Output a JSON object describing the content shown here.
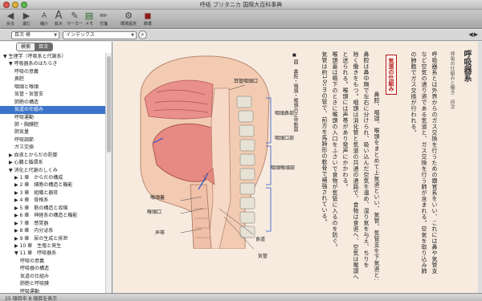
{
  "window": {
    "title": "呼吸 ブリタニカ 国際大百科事典"
  },
  "toolbar": {
    "buttons": [
      {
        "name": "back-button",
        "icon": "◀",
        "label": "戻る"
      },
      {
        "name": "forward-button",
        "icon": "▶",
        "label": "進む"
      },
      {
        "name": "font-smaller-button",
        "icon": "A",
        "label": "縮小"
      },
      {
        "name": "font-larger-button",
        "icon": "A",
        "label": "拡大"
      },
      {
        "name": "marker-button",
        "icon": "✎",
        "label": "マーカー"
      },
      {
        "name": "memo-button",
        "icon": "▤",
        "label": "メモ"
      },
      {
        "name": "note-button",
        "icon": "✏",
        "label": "付箋"
      },
      {
        "name": "settings-button",
        "icon": "⚙",
        "label": "環境設定"
      },
      {
        "name": "dictionary-button",
        "icon": "◼",
        "label": "辞書"
      }
    ]
  },
  "search": {
    "scope": "目次 検",
    "field": "インデックス"
  },
  "sidebar": {
    "tabs": [
      "検索",
      "目次"
    ],
    "tree": [
      {
        "label": "▼ 生理学（呼吸系と代謝系）",
        "indent": 0,
        "expanded": true,
        "selected": false
      },
      {
        "label": "▼ 呼吸器系のはたらき",
        "indent": 1,
        "expanded": true,
        "selected": false
      },
      {
        "label": "呼吸の意義",
        "indent": 2,
        "selected": false
      },
      {
        "label": "鼻腔",
        "indent": 2,
        "selected": false
      },
      {
        "label": "咽頭と喉頭",
        "indent": 2,
        "selected": false
      },
      {
        "label": "気管・気管支",
        "indent": 2,
        "selected": false
      },
      {
        "label": "肺胞の構造",
        "indent": 2,
        "selected": false
      },
      {
        "label": "気道の仕組み",
        "indent": 2,
        "selected": true
      },
      {
        "label": "呼吸運動",
        "indent": 2,
        "selected": false
      },
      {
        "label": "肺・胸膜腔",
        "indent": 2,
        "selected": false
      },
      {
        "label": "肺気量",
        "indent": 2,
        "selected": false
      },
      {
        "label": "呼吸調節",
        "indent": 2,
        "selected": false
      },
      {
        "label": "ガス交換",
        "indent": 2,
        "selected": false
      },
      {
        "label": "▶ 血液とからだの防御",
        "indent": 1,
        "selected": false
      },
      {
        "label": "▶ 心臓と循環系",
        "indent": 1,
        "selected": false
      },
      {
        "label": "▼ 消化と代謝のしくみ",
        "indent": 1,
        "expanded": true,
        "selected": false
      },
      {
        "label": "▶ 1 章　からだの構成",
        "indent": 2,
        "selected": false
      },
      {
        "label": "▶ 2 章　細胞の構造と機能",
        "indent": 2,
        "selected": false
      },
      {
        "label": "▶ 3 章　組織と器官",
        "indent": 2,
        "selected": false
      },
      {
        "label": "▶ 4 章　骨格系",
        "indent": 2,
        "selected": false
      },
      {
        "label": "▶ 5 章　筋の構造と収縮",
        "indent": 2,
        "selected": false
      },
      {
        "label": "▶ 6 章　神経系の構造と機能",
        "indent": 2,
        "selected": false
      },
      {
        "label": "▶ 7 章　感覚器",
        "indent": 2,
        "selected": false
      },
      {
        "label": "▶ 8 章　内分泌系",
        "indent": 2,
        "selected": false
      },
      {
        "label": "▶ 9 章　尿の生成と排泄",
        "indent": 2,
        "selected": false
      },
      {
        "label": "▶ 10 章　生殖と発生",
        "indent": 2,
        "selected": false
      },
      {
        "label": "▼ 11 章　呼吸器系",
        "indent": 2,
        "expanded": true,
        "selected": false
      },
      {
        "label": "呼吸の意義",
        "indent": 3,
        "selected": false
      },
      {
        "label": "呼吸器の構造",
        "indent": 3,
        "selected": false
      },
      {
        "label": "気道の仕組み",
        "indent": 3,
        "selected": false
      },
      {
        "label": "肺胞と呼吸膜",
        "indent": 3,
        "selected": false
      },
      {
        "label": "呼吸運動",
        "indent": 3,
        "selected": false
      }
    ]
  },
  "article": {
    "heading": "呼吸器系",
    "subheading": "呼吸の仕組みと働き　目次",
    "boxed_term": "気道の仕組み",
    "columns": [
      "呼吸器系とは外界からのガス交換を行うための器官系をいい、これには鼻や気管支",
      "など空気の通り道である気道と、ガス交換を行う肺が含まれる。空気を取り込み肺",
      "の肺胞でガス交換が行われる。",
      "鼻腔、咽頭、喉頭をまとめて上気道といい、気管、気管支を下気道という。",
      "鼻腔は鼻中隔で左右に分けられ、吸い込んだ空気を温め、湿り気を与え、ちりを",
      "除く働きをもつ。咽頭は消化管と気道の共通の通路で、食物は食道へ、空気は喉頭へ",
      "と送られる。喉頭には声帯があり発声にかかわる。",
      "喉頭蓋は嚥下のときに喉頭の入口をふさいで食物が気管に入るのを防ぐ。",
      "気管は約10cmの管で、前方を馬蹄形の軟骨で補強されている。"
    ],
    "figure_caption": "図　鼻腔・咽頭・喉頭の正中断面",
    "figure_labels": {
      "nasopharynx": "耳管咽頭口",
      "region1": "咽頭鼻部",
      "region2": "咽頭口部",
      "region3": "咽頭喉頭部",
      "epiglottis": "喉頭蓋",
      "vocal_fold": "喉頭口",
      "hyoid": "声帯",
      "esophagus": "食道",
      "trachea": "気管"
    }
  },
  "status": {
    "text": "25 項目中 8 項目を表示"
  }
}
